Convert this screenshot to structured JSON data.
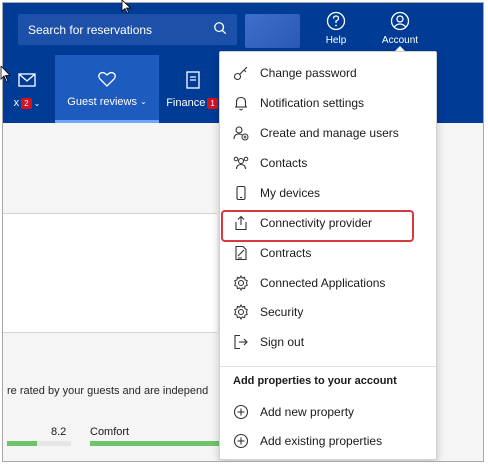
{
  "header": {
    "search_placeholder": "Search for reservations",
    "help_label": "Help",
    "account_label": "Account"
  },
  "nav": {
    "inbox_suffix": "x",
    "inbox_badge": "2",
    "guest_reviews_label": "Guest reviews",
    "finance_label": "Finance",
    "finance_badge": "1"
  },
  "menu": {
    "items": [
      {
        "label": "Change password",
        "icon": "key-icon"
      },
      {
        "label": "Notification settings",
        "icon": "bell-icon"
      },
      {
        "label": "Create and manage users",
        "icon": "user-add-icon"
      },
      {
        "label": "Contacts",
        "icon": "contacts-icon"
      },
      {
        "label": "My devices",
        "icon": "phone-icon"
      },
      {
        "label": "Connectivity provider",
        "icon": "upload-icon"
      },
      {
        "label": "Contracts",
        "icon": "contract-icon"
      },
      {
        "label": "Connected Applications",
        "icon": "gear-icon"
      },
      {
        "label": "Security",
        "icon": "gear-icon"
      },
      {
        "label": "Sign out",
        "icon": "sign-out-icon"
      }
    ],
    "section_title": "Add properties to your account",
    "add_items": [
      {
        "label": "Add new property",
        "icon": "plus-circle-icon"
      },
      {
        "label": "Add existing properties",
        "icon": "plus-circle-icon"
      }
    ],
    "highlighted_item": "Connectivity provider"
  },
  "background": {
    "rated_text": "re rated by your guests and are independ",
    "score": "8.2",
    "comfort_label": "Comfort"
  },
  "colors": {
    "header_blue": "#003b95",
    "highlight_red": "#d63a3f",
    "score_green": "#6ec46b"
  }
}
